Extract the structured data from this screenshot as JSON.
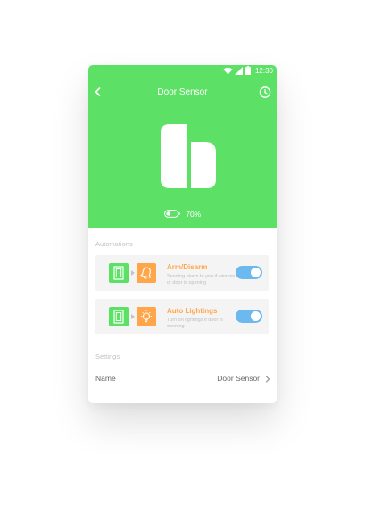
{
  "status_bar": {
    "time": "12:30"
  },
  "nav": {
    "title": "Door Sensor"
  },
  "device": {
    "battery": "70%"
  },
  "automations": {
    "label": "Automations",
    "items": [
      {
        "title": "Arm/Disarm",
        "description": "Sending alarm to you if window or door is opening",
        "enabled": true,
        "action_icon": "bell-icon"
      },
      {
        "title": "Auto Lightings",
        "description": "Turn on lightings if door is opening",
        "enabled": true,
        "action_icon": "light-bulb-icon"
      }
    ]
  },
  "settings": {
    "label": "Settings",
    "name_label": "Name",
    "name_value": "Door Sensor"
  },
  "colors": {
    "primary_green": "#5ce166",
    "accent_orange": "#ffa54a",
    "toggle_blue": "#6bb9ee"
  }
}
